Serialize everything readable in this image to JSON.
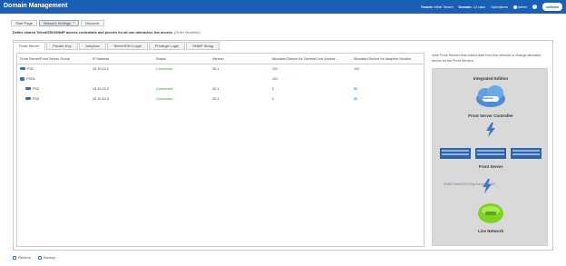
{
  "app": {
    "title": "Domain Management"
  },
  "header": {
    "tenant_label": "Tenant:",
    "tenant_value": "Initial Tenant",
    "domain_label": "Domain:",
    "domain_value": "12 case",
    "operations": "Operations",
    "user": "admin",
    "help": "?",
    "logo": "netbrain"
  },
  "subtabs": [
    {
      "label": "Start Page"
    },
    {
      "label": "Network Settings"
    },
    {
      "label": "Discover"
    }
  ],
  "description": {
    "bold": "Define shared Telnet/SSH/SNMP access credentials and proxies for all non-interactive live access.",
    "muted": "(Order Sensitive)"
  },
  "tabs": [
    {
      "label": "Front Server"
    },
    {
      "label": "Private Key"
    },
    {
      "label": "Jumpbox"
    },
    {
      "label": "Telnet/SSH Login"
    },
    {
      "label": "Privilege Login"
    },
    {
      "label": "SNMP String"
    }
  ],
  "table": {
    "columns": [
      "Front Server/Front Server Group",
      "IP Address",
      "Status",
      "Version",
      "Allocated Device for General Live Access",
      "Allocated Device for Adaptive Monitor"
    ],
    "rows": [
      {
        "name": "FS1",
        "ip": "10.10.10.1",
        "status": "Connected",
        "version": "10.1",
        "general": "100",
        "adaptive": "100"
      },
      {
        "name": "FSG1",
        "ip": "",
        "status": "",
        "version": "",
        "general": "100",
        "adaptive": ""
      },
      {
        "name": "FS2",
        "ip": "10.10.10.2",
        "status": "Connected",
        "version": "10.1",
        "general": "0",
        "adaptive": "50"
      },
      {
        "name": "FS3",
        "ip": "10.10.10.3",
        "status": "Connected",
        "version": "10.1",
        "general": "0",
        "adaptive": "50"
      }
    ]
  },
  "diagram": {
    "intro": "View Front Servers that collect data from live network or change allocated device for the Front Servers.",
    "edition": "Integrated Edition",
    "controller": "Front Server Controller",
    "front_server": "Front Server",
    "protocols": "SNMP/Telnet/SSH Ping/Traceroute/API",
    "live_network": "Live Network",
    "cloud_logo": "netbrain"
  },
  "footer": {
    "restore": "Restore",
    "backup": "Backup"
  },
  "colors": {
    "header": "#1a5fb4",
    "connected": "#2e9e2e",
    "link": "#1a5fb4",
    "live_network": "#7ed321"
  }
}
